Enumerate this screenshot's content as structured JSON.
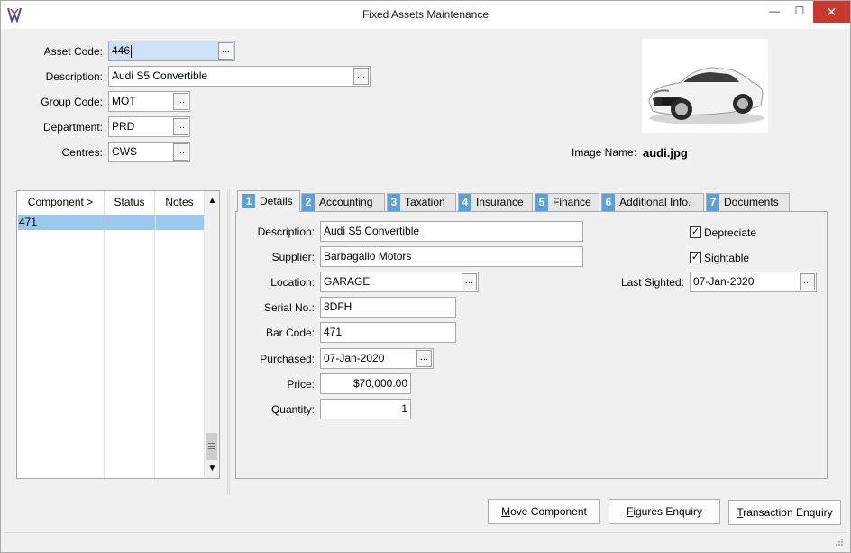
{
  "window": {
    "title": "Fixed Assets Maintenance",
    "minimize_glyph": "—",
    "maximize_glyph": "☐",
    "close_glyph": "✕",
    "accent": "#5aa0dc",
    "selection_color": "#99c9ef",
    "close_color": "#c8392b"
  },
  "header": {
    "asset_code_label": "Asset Code:",
    "asset_code": "446",
    "description_label": "Description:",
    "description": "Audi S5 Convertible",
    "group_code_label": "Group Code:",
    "group_code": "MOT",
    "department_label": "Department:",
    "department": "PRD",
    "centres_label": "Centres:",
    "centres": "CWS",
    "ellipsis": "...",
    "image_name_label": "Image Name:",
    "image_name": "audi.jpg",
    "image_icon": "car-photo"
  },
  "components": {
    "columns": [
      "Component >",
      "Status",
      "Notes"
    ],
    "rows": [
      [
        "471",
        "",
        ""
      ]
    ],
    "scroll_up": "▲",
    "scroll_down": "▼"
  },
  "tabs": [
    {
      "num": "1",
      "label": "Details"
    },
    {
      "num": "2",
      "label": "Accounting"
    },
    {
      "num": "3",
      "label": "Taxation"
    },
    {
      "num": "4",
      "label": "Insurance"
    },
    {
      "num": "5",
      "label": "Finance"
    },
    {
      "num": "6",
      "label": "Additional Info."
    },
    {
      "num": "7",
      "label": "Documents"
    }
  ],
  "details": {
    "description_label": "Description:",
    "description": "Audi S5 Convertible",
    "supplier_label": "Supplier:",
    "supplier": "Barbagallo Motors",
    "location_label": "Location:",
    "location": "GARAGE",
    "serial_label": "Serial No.:",
    "serial": "8DFH",
    "barcode_label": "Bar Code:",
    "barcode": "471",
    "purchased_label": "Purchased:",
    "purchased": "07-Jan-2020",
    "price_label": "Price:",
    "price": "$70,000.00",
    "quantity_label": "Quantity:",
    "quantity": "1",
    "depreciate_label": "Depreciate",
    "depreciate_checked": true,
    "sightable_label": "Sightable",
    "sightable_checked": true,
    "last_sighted_label": "Last Sighted:",
    "last_sighted": "07-Jan-2020",
    "check_glyph": "✓"
  },
  "buttons": {
    "move_component": {
      "pre": "",
      "ul": "M",
      "post": "ove Component"
    },
    "figures_enquiry": {
      "pre": "",
      "ul": "F",
      "post": "igures Enquiry"
    },
    "transaction_enquiry": {
      "pre": "",
      "ul": "T",
      "post": "ransaction Enquiry"
    }
  }
}
